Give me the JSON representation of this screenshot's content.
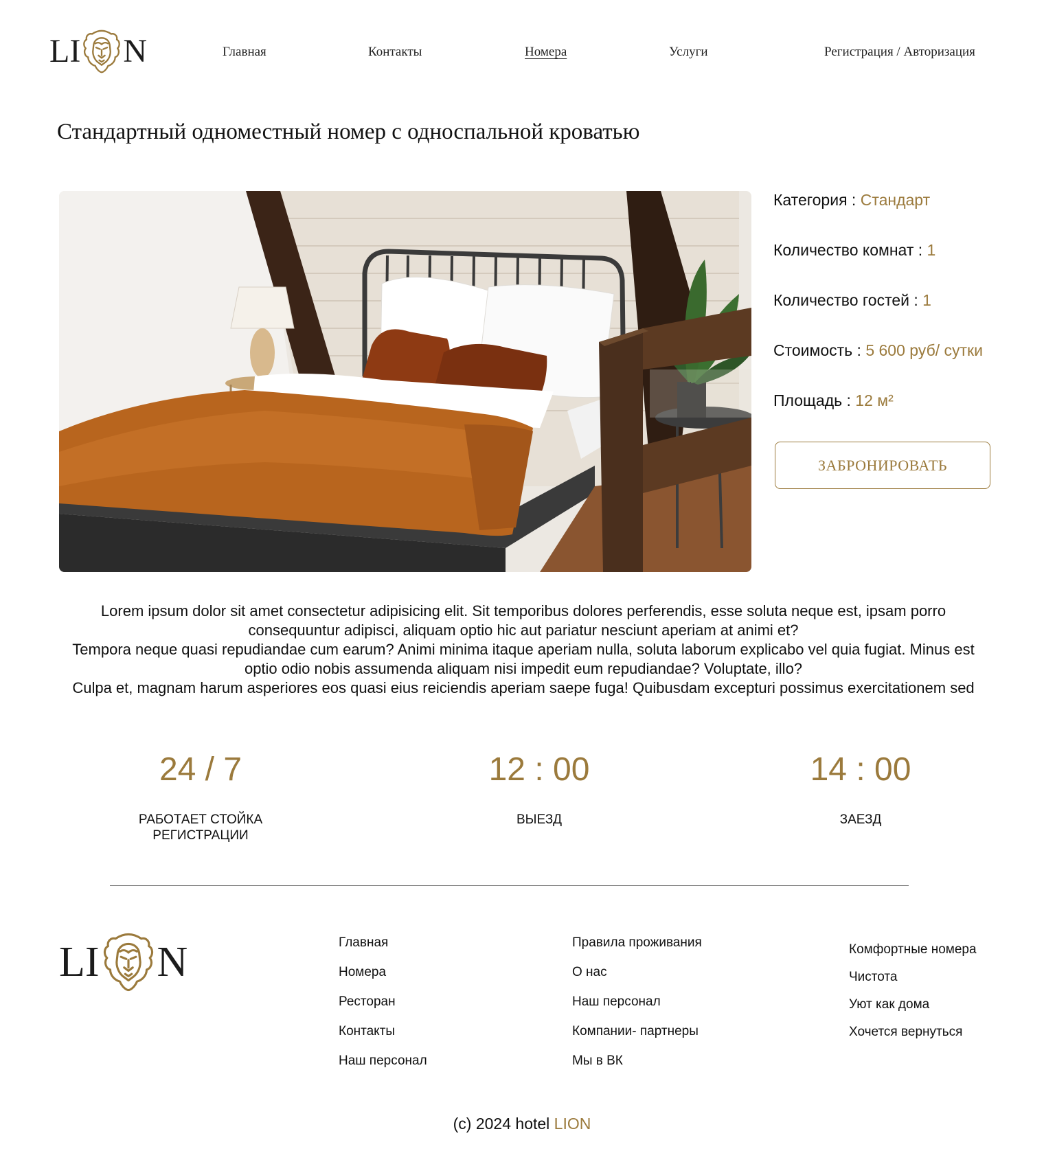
{
  "brand": {
    "left_letters": "LI",
    "right_letters": "N",
    "accent": "#9b7a3c"
  },
  "nav": {
    "items": [
      {
        "label": "Главная"
      },
      {
        "label": "Контакты"
      },
      {
        "label": "Номера",
        "active": true
      },
      {
        "label": "Услуги"
      },
      {
        "label": "Регистрация / Авторизация"
      }
    ]
  },
  "room": {
    "title": "Стандартный одноместный номер с односпальной кроватью",
    "details": [
      {
        "label": "Категория :",
        "value": "Стандарт"
      },
      {
        "label": "Количество комнат :",
        "value": "1"
      },
      {
        "label": "Количество гостей :",
        "value": "1"
      },
      {
        "label": "Стоимость :",
        "value": "5 600 руб/ сутки"
      },
      {
        "label": "Площадь :",
        "value": "12 м²"
      }
    ],
    "book_label": "ЗАБРОНИРОВАТЬ",
    "description": [
      "Lorem ipsum dolor sit amet consectetur adipisicing elit. Sit temporibus dolores perferendis, esse soluta neque est, ipsam porro consequuntur adipisci, aliquam optio hic aut pariatur nesciunt aperiam at animi et?",
      "Tempora neque quasi repudiandae cum earum? Animi minima itaque aperiam nulla, soluta laborum explicabo vel quia fugiat. Minus est optio odio nobis assumenda aliquam nisi impedit eum repudiandae? Voluptate, illo?",
      "Culpa et, magnam harum asperiores eos quasi eius reiciendis aperiam saepe fuga! Quibusdam excepturi possimus exercitationem sed"
    ]
  },
  "stats": [
    {
      "value": "24 / 7",
      "label": "РАБОТАЕТ СТОЙКА РЕГИСТРАЦИИ"
    },
    {
      "value": "12 : 00",
      "label": "ВЫЕЗД"
    },
    {
      "value": "14 : 00",
      "label": "ЗАЕЗД"
    }
  ],
  "footer": {
    "col1": [
      "Главная",
      "Номера",
      "Ресторан",
      "Контакты",
      "Наш персонал"
    ],
    "col2": [
      "Правила проживания",
      "О нас",
      "Наш персонал",
      "Компании- партнеры",
      "Мы в ВК"
    ],
    "col3": [
      "Комфортные номера",
      "Чистота",
      "Уют как дома",
      "Хочется вернуться"
    ],
    "copyright_prefix": "(c) 2024 hotel",
    "copyright_brand": "LION"
  }
}
